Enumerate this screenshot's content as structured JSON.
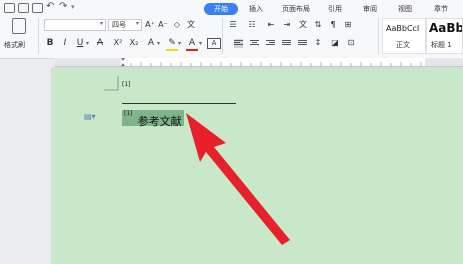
{
  "tabs": [
    "开始",
    "插入",
    "页面布局",
    "引用",
    "审阅",
    "视图",
    "章节"
  ],
  "format_painter_label": "格式刷",
  "font": {
    "name": "",
    "size": "四号"
  },
  "styles": [
    {
      "preview": "AaBbCcI",
      "name": "正文"
    },
    {
      "preview": "AaBb",
      "name": "标题 1"
    }
  ],
  "document": {
    "footnote_marker": "[1]",
    "reference_marker": "[1]",
    "reference_text": "参考文献"
  },
  "colors": {
    "accent": "#3c7ff0",
    "page_background": "#c8e8c9",
    "selection": "#7fb38a",
    "arrow": "#e8202a"
  }
}
